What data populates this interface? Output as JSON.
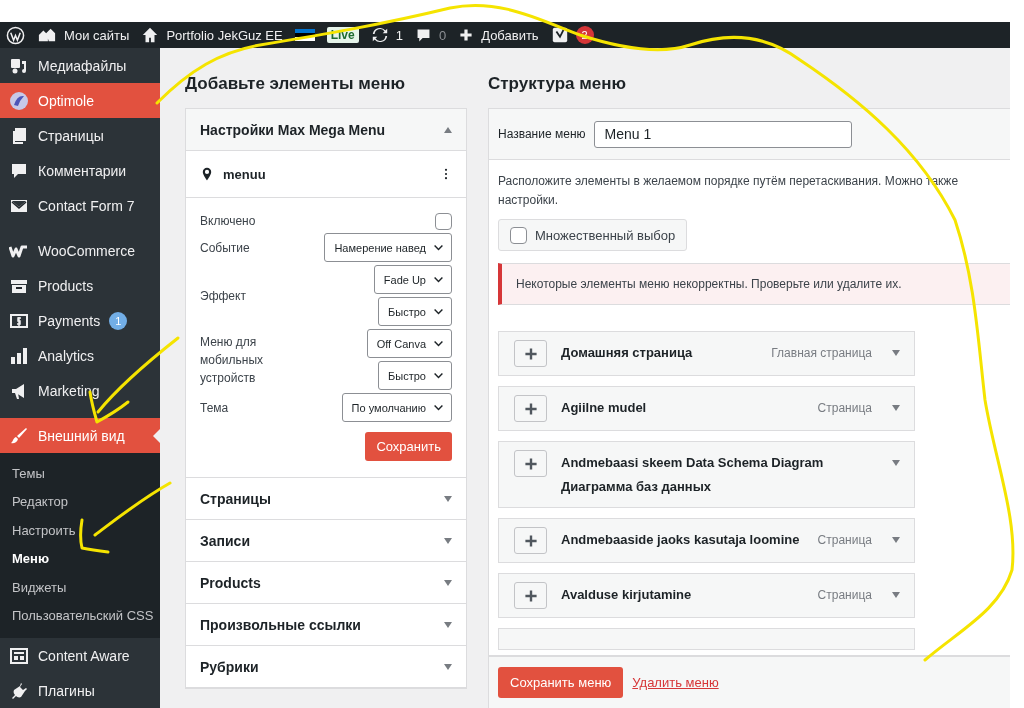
{
  "admin_bar": {
    "my_sites": "Мои сайты",
    "site": "Portfolio JekGuz EE",
    "live": "Live",
    "updates": "1",
    "comments": "0",
    "new": "Добавить",
    "seo_count": "2"
  },
  "sidebar": {
    "items": [
      {
        "label": "Медиафайлы",
        "selected": false,
        "highlighted": false
      },
      {
        "label": "Optimole",
        "selected": false,
        "highlighted": true
      },
      {
        "label": "Страницы",
        "selected": false,
        "highlighted": false
      },
      {
        "label": "Комментарии",
        "selected": false,
        "highlighted": false
      },
      {
        "label": "Contact Form 7",
        "selected": false,
        "highlighted": false
      },
      {
        "label": "WooCommerce",
        "selected": false,
        "highlighted": false,
        "group_start": true
      },
      {
        "label": "Products",
        "selected": false,
        "highlighted": false
      },
      {
        "label": "Payments",
        "selected": false,
        "highlighted": false,
        "badge": "1"
      },
      {
        "label": "Analytics",
        "selected": false,
        "highlighted": false
      },
      {
        "label": "Marketing",
        "selected": false,
        "highlighted": false
      },
      {
        "label": "Внешний вид",
        "selected": true,
        "highlighted": false,
        "group_start": true,
        "children": [
          {
            "label": "Темы",
            "selected": false
          },
          {
            "label": "Редактор",
            "selected": false
          },
          {
            "label": "Настроить",
            "selected": false
          },
          {
            "label": "Меню",
            "selected": true
          },
          {
            "label": "Виджеты",
            "selected": false
          },
          {
            "label": "Пользовательский CSS",
            "selected": false
          }
        ]
      },
      {
        "label": "Content Aware",
        "selected": false,
        "highlighted": false
      },
      {
        "label": "Плагины",
        "selected": false,
        "highlighted": false
      }
    ]
  },
  "add_items": {
    "heading": "Добавьте элементы меню",
    "sections": [
      {
        "title": "Настройки Max Mega Menu",
        "expanded": true,
        "location": "menuu",
        "settings": [
          {
            "kind": "checkbox",
            "label": "Включено",
            "checked": false
          },
          {
            "kind": "select",
            "label": "Событие",
            "selects": [
              "Намерение навед"
            ]
          },
          {
            "kind": "select",
            "label": "Эффект",
            "selects": [
              "Fade Up",
              "Быстро"
            ]
          },
          {
            "kind": "select",
            "label": "Меню для мобильных устройств",
            "selects": [
              "Off Canva",
              "Быстро"
            ]
          },
          {
            "kind": "select",
            "label": "Тема",
            "selects": [
              "По умолчанию"
            ]
          }
        ],
        "save": "Сохранить"
      },
      {
        "title": "Страницы",
        "expanded": false
      },
      {
        "title": "Записи",
        "expanded": false
      },
      {
        "title": "Products",
        "expanded": false
      },
      {
        "title": "Произвольные ссылки",
        "expanded": false
      },
      {
        "title": "Рубрики",
        "expanded": false
      }
    ]
  },
  "structure": {
    "heading": "Структура меню",
    "name_label": "Название меню",
    "name_value": "Menu 1",
    "description": [
      "Расположите элементы в желаемом порядке путём перетаскивания. Можно также",
      "настройки."
    ],
    "bulk_select": {
      "label": "Множественный выбор",
      "checked": false
    },
    "notice": "Некоторые элементы меню некорректны. Проверьте или удалите их.",
    "items": [
      {
        "title": "Домашняя страница",
        "type": "Главная страница"
      },
      {
        "title": "Agiilne mudel",
        "type": "Страница"
      },
      {
        "title": "Andmebaasi skeem Data Schema Diagram Диаграмма баз данных"
      },
      {
        "title": "Andmebaaside jaoks kasutaja loomine",
        "type": "Страница"
      },
      {
        "title": "Avalduse kirjutamine",
        "type": "Страница"
      }
    ],
    "save": "Сохранить меню",
    "delete": "Удалить меню"
  }
}
